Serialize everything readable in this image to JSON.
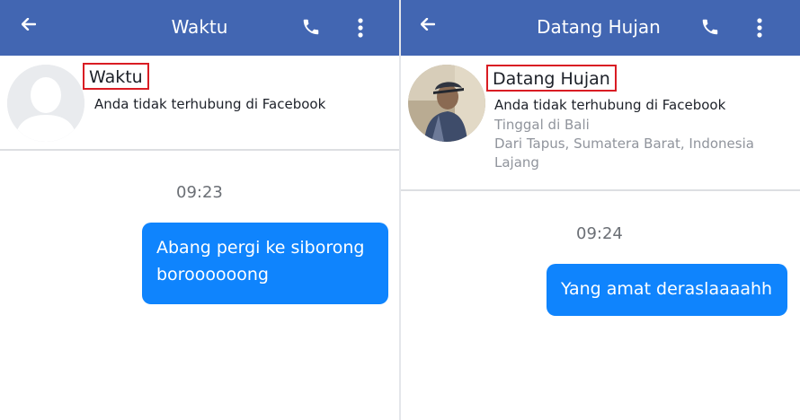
{
  "left": {
    "header": {
      "title": "Waktu"
    },
    "profile": {
      "name": "Waktu",
      "connection": "Anda tidak terhubung di Facebook"
    },
    "messages": {
      "timestamp": "09:23",
      "bubble_text": "Abang pergi ke siborong boroooooong"
    }
  },
  "right": {
    "header": {
      "title": "Datang Hujan"
    },
    "profile": {
      "name": "Datang Hujan",
      "connection": "Anda tidak terhubung di Facebook",
      "details": [
        "Tinggal di Bali",
        "Dari Tapus, Sumatera Barat, Indonesia",
        "Lajang"
      ]
    },
    "messages": {
      "timestamp": "09:24",
      "bubble_text": "Yang amat deraslaaaahh"
    }
  },
  "icons": {
    "back": "back-arrow-icon",
    "call": "phone-icon",
    "menu": "more-vertical-icon"
  },
  "colors": {
    "appbar": "#4266b2",
    "bubble": "#0f84fd",
    "highlight_box": "#d91c23"
  }
}
